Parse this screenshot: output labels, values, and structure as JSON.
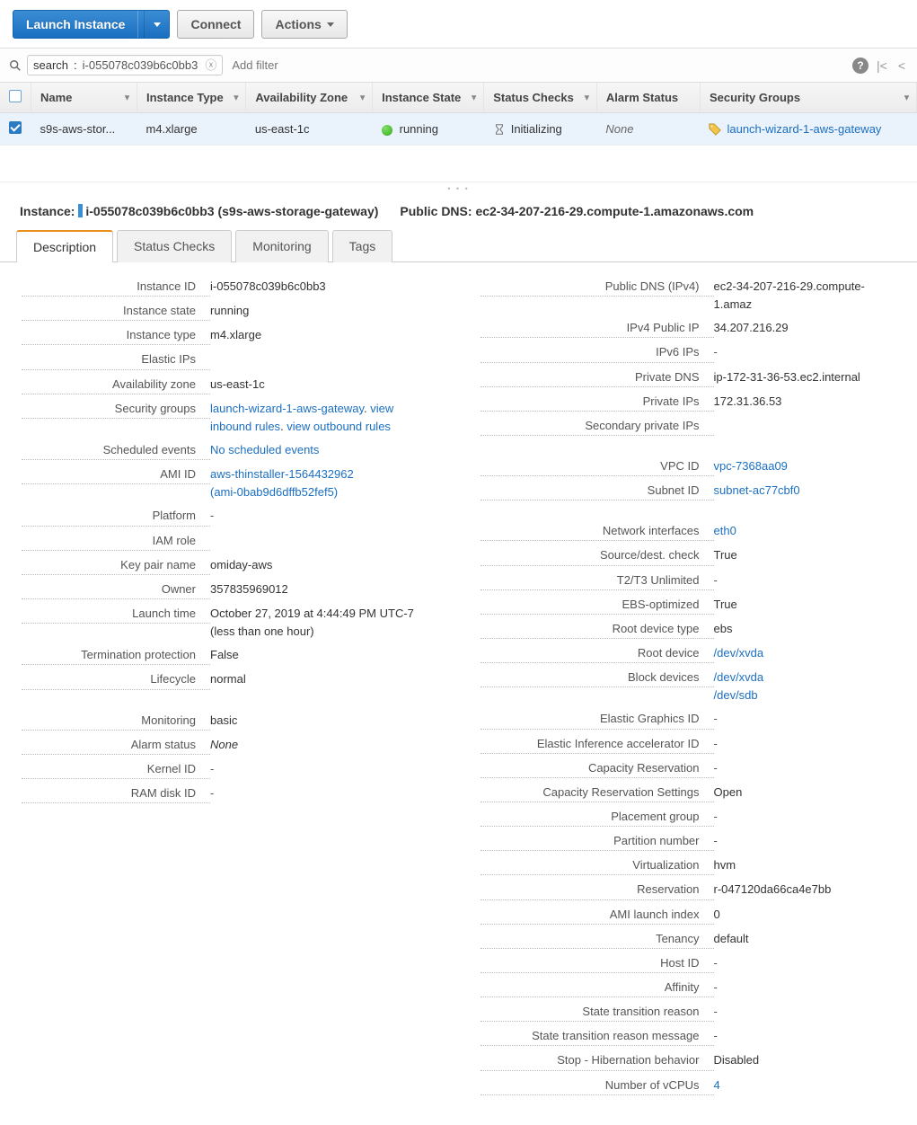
{
  "toolbar": {
    "launch": "Launch Instance",
    "connect": "Connect",
    "actions": "Actions"
  },
  "filter": {
    "tag_key": "search",
    "tag_val": "i-055078c039b6c0bb3",
    "placeholder": "Add filter"
  },
  "columns": [
    "Name",
    "Instance Type",
    "Availability Zone",
    "Instance State",
    "Status Checks",
    "Alarm Status",
    "Security Groups"
  ],
  "row": {
    "name": "s9s-aws-stor...",
    "type": "m4.xlarge",
    "az": "us-east-1c",
    "state": "running",
    "status": "Initializing",
    "alarm": "None",
    "sg": "launch-wizard-1-aws-gateway"
  },
  "header": {
    "instance_label": "Instance:",
    "instance_id": "i-055078c039b6c0bb3 (s9s-aws-storage-gateway)",
    "dns_label": "Public DNS:",
    "dns_value": "ec2-34-207-216-29.compute-1.amazonaws.com"
  },
  "tabs": [
    "Description",
    "Status Checks",
    "Monitoring",
    "Tags"
  ],
  "left": {
    "instance_id": {
      "k": "Instance ID",
      "v": "i-055078c039b6c0bb3"
    },
    "state": {
      "k": "Instance state",
      "v": "running"
    },
    "type": {
      "k": "Instance type",
      "v": "m4.xlarge"
    },
    "eip": {
      "k": "Elastic IPs",
      "v": ""
    },
    "az": {
      "k": "Availability zone",
      "v": "us-east-1c"
    },
    "sg": {
      "k": "Security groups",
      "sg_name": "launch-wizard-1-aws-gateway",
      "dot": ". ",
      "inbound": "view inbound rules",
      "dot2": ". ",
      "outbound": "view outbound rules"
    },
    "sched": {
      "k": "Scheduled events",
      "v": "No scheduled events"
    },
    "ami": {
      "k": "AMI ID",
      "l1": "aws-thinstaller-1564432962",
      "l2": "(ami-0bab9d6dffb52fef5)"
    },
    "platform": {
      "k": "Platform",
      "v": "-"
    },
    "iam": {
      "k": "IAM role",
      "v": ""
    },
    "key": {
      "k": "Key pair name",
      "v": "omiday-aws"
    },
    "owner": {
      "k": "Owner",
      "v": "357835969012"
    },
    "launch": {
      "k": "Launch time",
      "v": "October 27, 2019 at 4:44:49 PM UTC-7 (less than one hour)"
    },
    "term": {
      "k": "Termination protection",
      "v": "False"
    },
    "life": {
      "k": "Lifecycle",
      "v": "normal"
    },
    "mon": {
      "k": "Monitoring",
      "v": "basic"
    },
    "alarm": {
      "k": "Alarm status",
      "v": "None"
    },
    "kernel": {
      "k": "Kernel ID",
      "v": "-"
    },
    "ram": {
      "k": "RAM disk ID",
      "v": "-"
    }
  },
  "right": {
    "pdns": {
      "k": "Public DNS (IPv4)",
      "v": "ec2-34-207-216-29.compute-1.amaz"
    },
    "pip": {
      "k": "IPv4 Public IP",
      "v": "34.207.216.29"
    },
    "ipv6": {
      "k": "IPv6 IPs",
      "v": "-"
    },
    "privdns": {
      "k": "Private DNS",
      "v": "ip-172-31-36-53.ec2.internal"
    },
    "privip": {
      "k": "Private IPs",
      "v": "172.31.36.53"
    },
    "secip": {
      "k": "Secondary private IPs",
      "v": ""
    },
    "vpc": {
      "k": "VPC ID",
      "v": "vpc-7368aa09"
    },
    "subnet": {
      "k": "Subnet ID",
      "v": "subnet-ac77cbf0"
    },
    "ni": {
      "k": "Network interfaces",
      "v": "eth0"
    },
    "src": {
      "k": "Source/dest. check",
      "v": "True"
    },
    "t2t3": {
      "k": "T2/T3 Unlimited",
      "v": "-"
    },
    "ebs": {
      "k": "EBS-optimized",
      "v": "True"
    },
    "rdt": {
      "k": "Root device type",
      "v": "ebs"
    },
    "rd": {
      "k": "Root device",
      "v": "/dev/xvda"
    },
    "bd": {
      "k": "Block devices",
      "v1": "/dev/xvda",
      "v2": "/dev/sdb"
    },
    "eg": {
      "k": "Elastic Graphics ID",
      "v": "-"
    },
    "eia": {
      "k": "Elastic Inference accelerator ID",
      "v": "-"
    },
    "cr": {
      "k": "Capacity Reservation",
      "v": "-"
    },
    "crs": {
      "k": "Capacity Reservation Settings",
      "v": "Open"
    },
    "pg": {
      "k": "Placement group",
      "v": "-"
    },
    "pn": {
      "k": "Partition number",
      "v": "-"
    },
    "virt": {
      "k": "Virtualization",
      "v": "hvm"
    },
    "res": {
      "k": "Reservation",
      "v": "r-047120da66ca4e7bb"
    },
    "ali": {
      "k": "AMI launch index",
      "v": "0"
    },
    "ten": {
      "k": "Tenancy",
      "v": "default"
    },
    "host": {
      "k": "Host ID",
      "v": "-"
    },
    "aff": {
      "k": "Affinity",
      "v": "-"
    },
    "str": {
      "k": "State transition reason",
      "v": "-"
    },
    "strm": {
      "k": "State transition reason message",
      "v": "-"
    },
    "hib": {
      "k": "Stop - Hibernation behavior",
      "v": "Disabled"
    },
    "vcpu": {
      "k": "Number of vCPUs",
      "v": "4"
    }
  }
}
